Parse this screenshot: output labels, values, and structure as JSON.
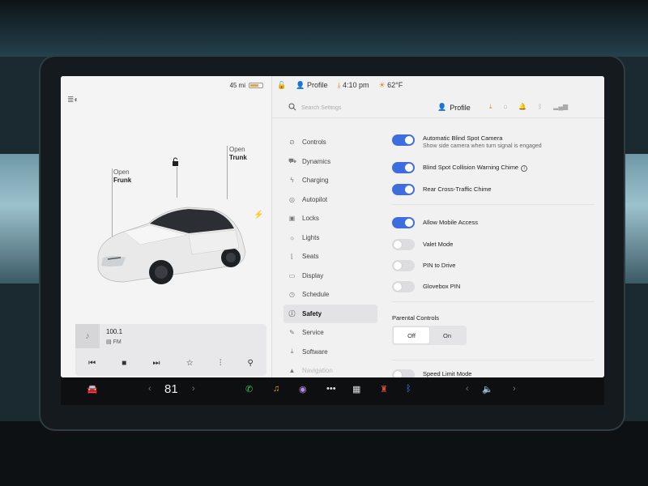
{
  "left_status": {
    "range": "45 mi"
  },
  "car_labels": {
    "frunk_line1": "Open",
    "frunk_line2": "Frunk",
    "trunk_line1": "Open",
    "trunk_line2": "Trunk"
  },
  "media": {
    "station": "100.1",
    "band": "FM"
  },
  "topbar": {
    "profile": "Profile",
    "time": "4:10 pm",
    "temperature": "62°F"
  },
  "search": {
    "placeholder": "Search Settings"
  },
  "header_profile": "Profile",
  "menu": [
    {
      "label": "Controls",
      "icon": "toggle-icon"
    },
    {
      "label": "Dynamics",
      "icon": "car-icon"
    },
    {
      "label": "Charging",
      "icon": "bolt-icon"
    },
    {
      "label": "Autopilot",
      "icon": "steering-wheel-icon"
    },
    {
      "label": "Locks",
      "icon": "lock-icon"
    },
    {
      "label": "Lights",
      "icon": "light-icon"
    },
    {
      "label": "Seats",
      "icon": "seat-icon"
    },
    {
      "label": "Display",
      "icon": "display-icon"
    },
    {
      "label": "Schedule",
      "icon": "clock-icon"
    },
    {
      "label": "Safety",
      "icon": "safety-icon",
      "active": true
    },
    {
      "label": "Service",
      "icon": "wrench-icon"
    },
    {
      "label": "Software",
      "icon": "download-icon"
    },
    {
      "label": "Navigation",
      "icon": "navigation-icon"
    }
  ],
  "settings": {
    "blind_spot_camera": {
      "label": "Automatic Blind Spot Camera",
      "sub": "Show side camera when turn signal is engaged",
      "on": true
    },
    "blind_spot_chime": {
      "label": "Blind Spot Collision Warning Chime",
      "on": true
    },
    "rear_cross_traffic": {
      "label": "Rear Cross-Traffic Chime",
      "on": true
    },
    "mobile_access": {
      "label": "Allow Mobile Access",
      "on": true
    },
    "valet_mode": {
      "label": "Valet Mode",
      "on": false
    },
    "pin_to_drive": {
      "label": "PIN to Drive",
      "on": false
    },
    "glovebox_pin": {
      "label": "Glovebox PIN",
      "on": false
    },
    "parental_controls": {
      "label": "Parental Controls",
      "options": [
        "Off",
        "On"
      ],
      "selected": "Off"
    },
    "speed_limit_mode": {
      "label": "Speed Limit Mode",
      "on": false
    }
  },
  "taskbar": {
    "temperature": "81"
  },
  "colors": {
    "toggle_on": "#3e6de0",
    "download_accent": "#e0892d",
    "screen_bg": "#f1f1f2"
  }
}
